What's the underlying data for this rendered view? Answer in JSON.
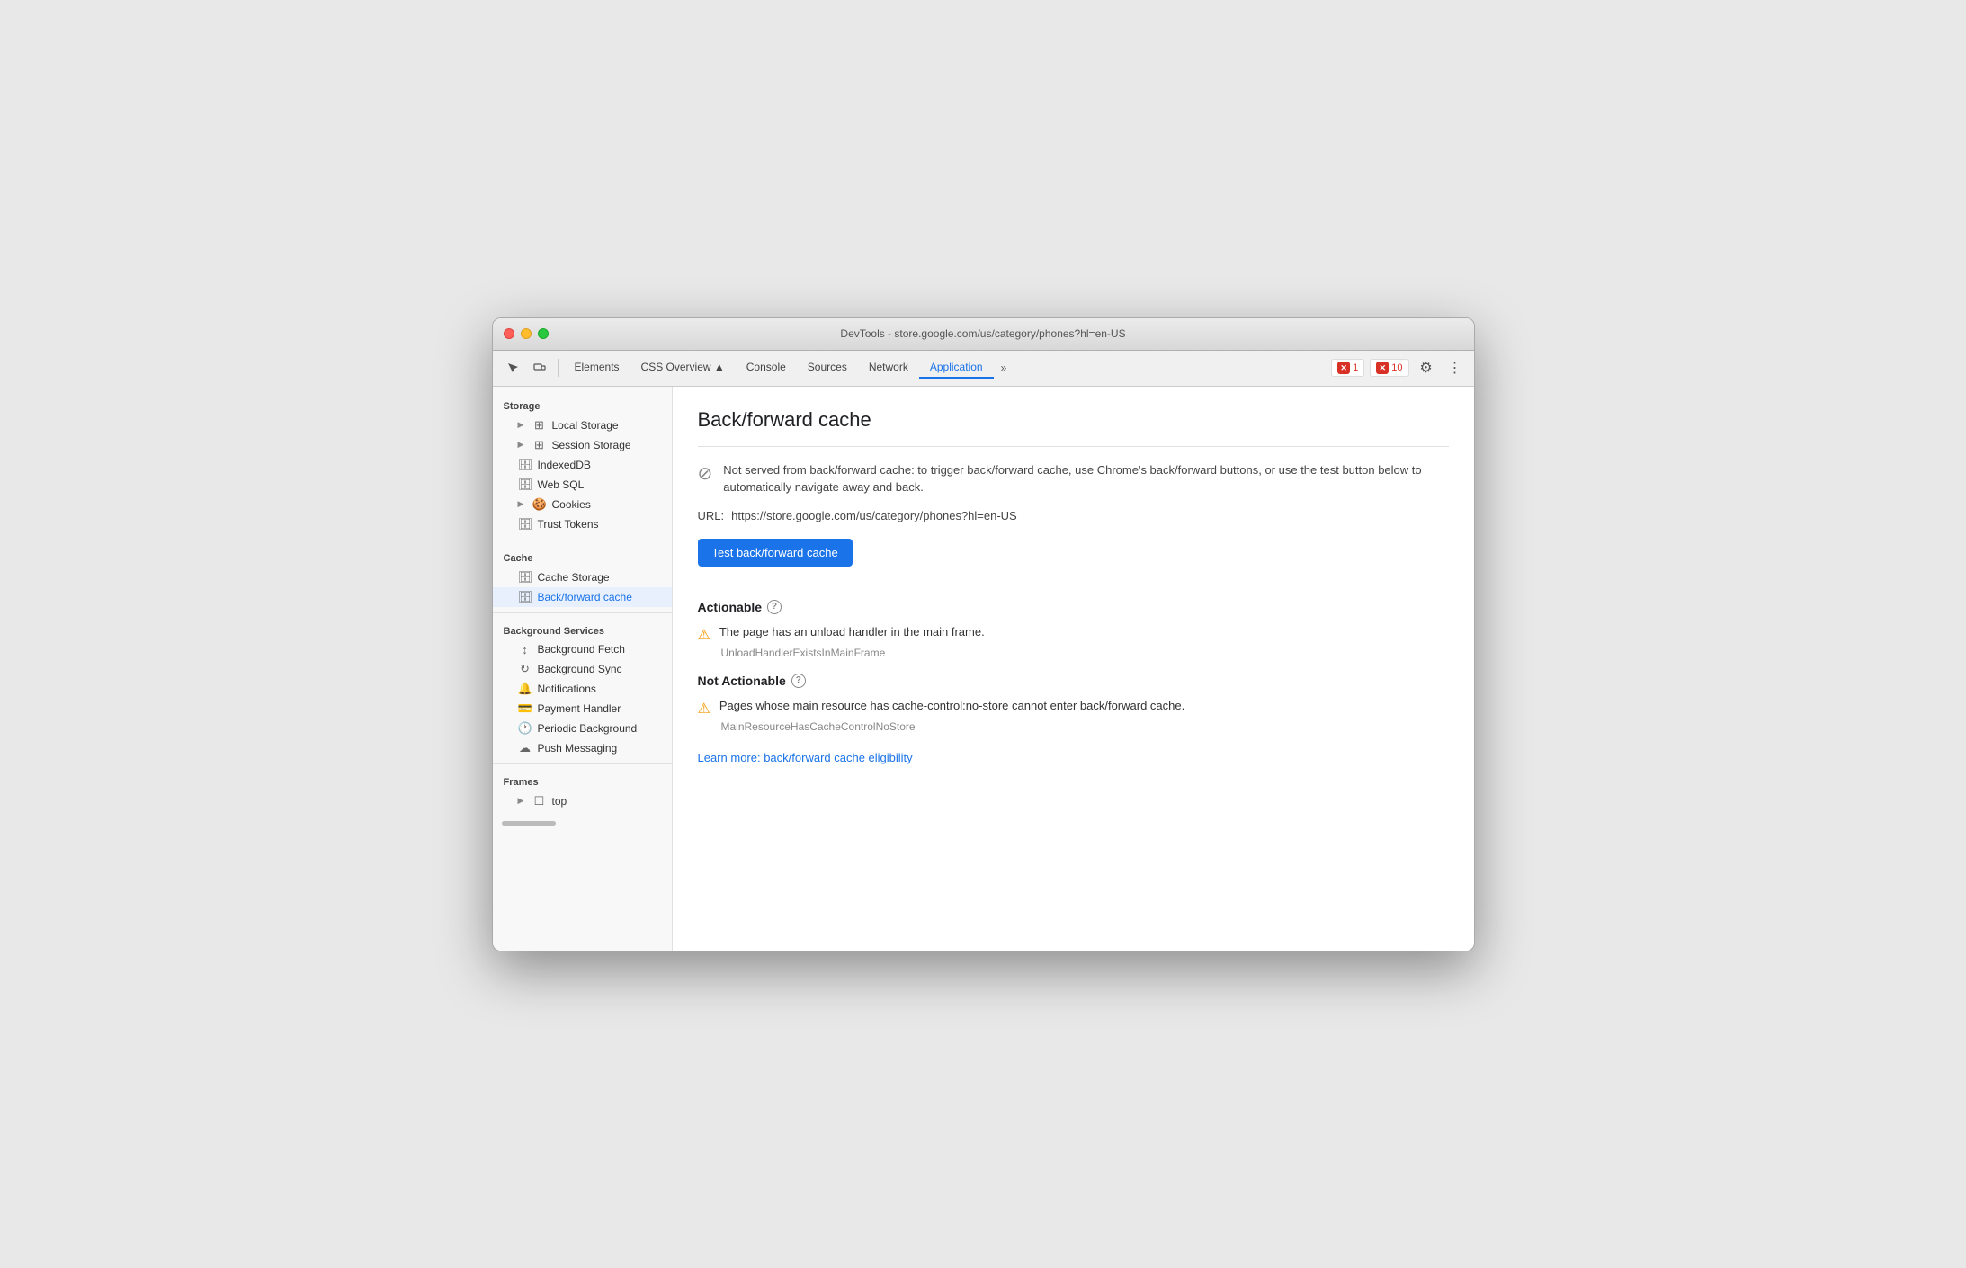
{
  "window": {
    "title": "DevTools - store.google.com/us/category/phones?hl=en-US"
  },
  "toolbar": {
    "tabs": [
      {
        "label": "Elements",
        "active": false
      },
      {
        "label": "CSS Overview ▲",
        "active": false
      },
      {
        "label": "Console",
        "active": false
      },
      {
        "label": "Sources",
        "active": false
      },
      {
        "label": "Network",
        "active": false
      },
      {
        "label": "Application",
        "active": true
      }
    ],
    "more_label": "»",
    "error_count": "1",
    "warning_count": "10"
  },
  "sidebar": {
    "storage_label": "Storage",
    "local_storage": "Local Storage",
    "session_storage": "Session Storage",
    "indexed_db": "IndexedDB",
    "web_sql": "Web SQL",
    "cookies": "Cookies",
    "trust_tokens": "Trust Tokens",
    "cache_label": "Cache",
    "cache_storage": "Cache Storage",
    "back_forward_cache": "Back/forward cache",
    "background_services_label": "Background Services",
    "background_fetch": "Background Fetch",
    "background_sync": "Background Sync",
    "notifications": "Notifications",
    "payment_handler": "Payment Handler",
    "periodic_background": "Periodic Background",
    "push_messaging": "Push Messaging",
    "frames_label": "Frames",
    "top": "top"
  },
  "content": {
    "title": "Back/forward cache",
    "info_text": "Not served from back/forward cache: to trigger back/forward cache, use Chrome's back/forward buttons, or use the test button below to automatically navigate away and back.",
    "url_label": "URL:",
    "url_value": "https://store.google.com/us/category/phones?hl=en-US",
    "test_button": "Test back/forward cache",
    "actionable_label": "Actionable",
    "actionable_warning_text": "The page has an unload handler in the main frame.",
    "actionable_warning_code": "UnloadHandlerExistsInMainFrame",
    "not_actionable_label": "Not Actionable",
    "not_actionable_warning_text": "Pages whose main resource has cache-control:no-store cannot enter back/forward cache.",
    "not_actionable_warning_code": "MainResourceHasCacheControlNoStore",
    "learn_more": "Learn more: back/forward cache eligibility"
  }
}
